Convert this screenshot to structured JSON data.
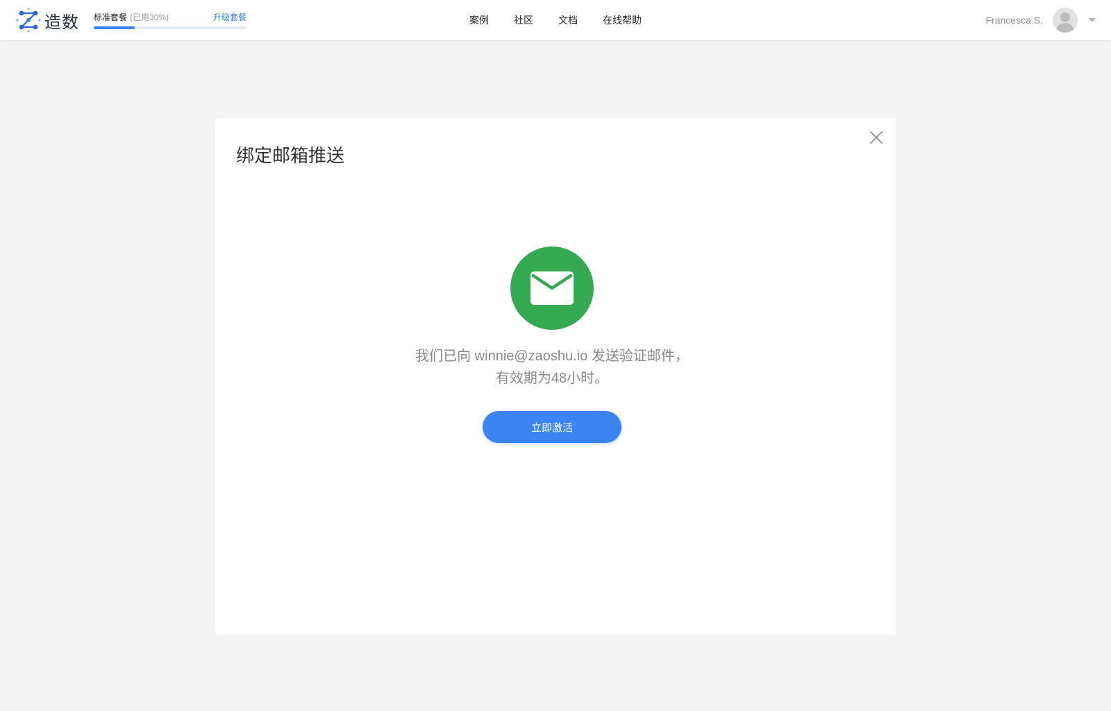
{
  "brand": {
    "name": "造数",
    "logo_icon": "molecule-z-icon",
    "accent_color": "#3c82f0"
  },
  "plan": {
    "name": "标准套餐",
    "usage_label": "(已用30%)",
    "usage_fraction": 0.27,
    "upgrade_label": "升级套餐"
  },
  "nav": {
    "items": [
      {
        "label": "案例"
      },
      {
        "label": "社区"
      },
      {
        "label": "文档"
      },
      {
        "label": "在线帮助"
      }
    ]
  },
  "user": {
    "name": "Francesca S.",
    "avatar_icon": "user-avatar-icon",
    "menu_icon": "caret-down-icon"
  },
  "dialog": {
    "title": "绑定邮箱推送",
    "close_icon": "close-icon",
    "status_icon": "mail-icon",
    "status_color": "#35a852",
    "message": "我们已向 winnie@zaoshu.io 发送验证邮件，有效期为48小时。",
    "button_label": "立即激活",
    "button_color": "#3d84f3"
  }
}
